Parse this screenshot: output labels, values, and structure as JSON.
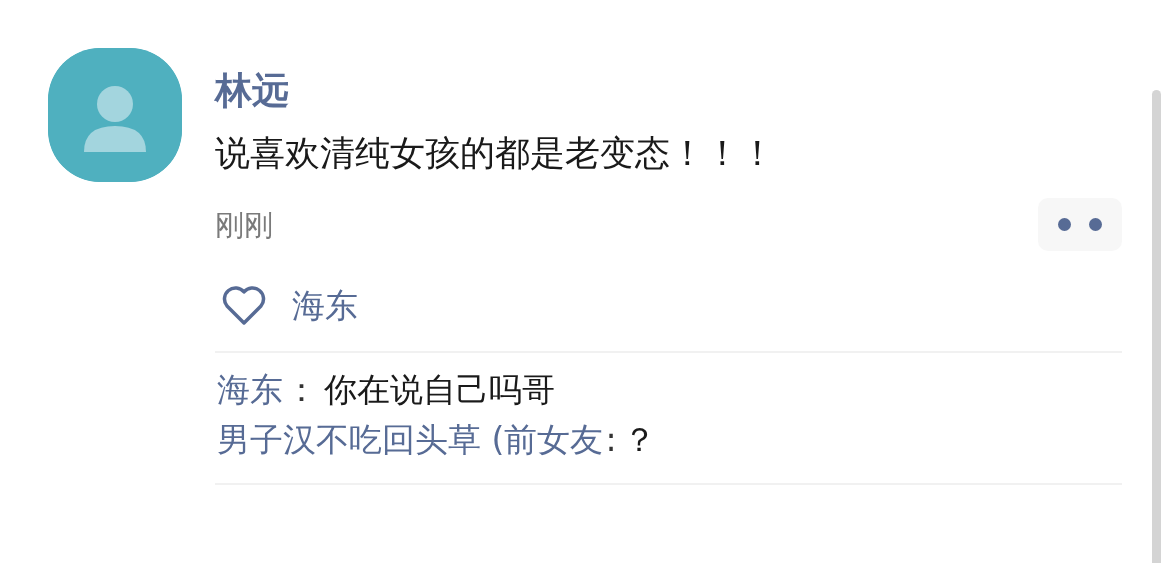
{
  "post": {
    "author": "林远",
    "text": "说喜欢清纯女孩的都是老变态！！！",
    "time": "刚刚"
  },
  "likes": [
    "海东"
  ],
  "comments": [
    {
      "author": "海东",
      "separator": "：",
      "text": "你在说自己吗哥"
    },
    {
      "author": "男子汉不吃回头草 (前女友",
      "separator": ":",
      "text": "？"
    }
  ]
}
